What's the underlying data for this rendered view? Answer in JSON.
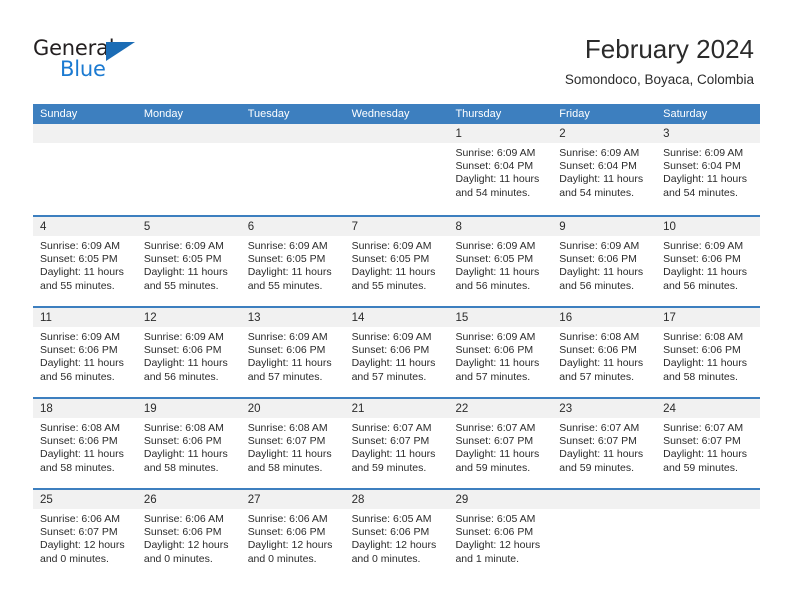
{
  "brand": {
    "name_part1": "General",
    "name_part2": "Blue",
    "triangle_color": "#1b6cb5",
    "blue_color": "#1b7ad1"
  },
  "header": {
    "title": "February 2024",
    "subtitle": "Somondoco, Boyaca, Colombia"
  },
  "theme": {
    "header_blue": "#3d7fbf",
    "day_band_gray": "#f1f1f1",
    "text_color": "#2b2b2b"
  },
  "weekdays": [
    "Sunday",
    "Monday",
    "Tuesday",
    "Wednesday",
    "Thursday",
    "Friday",
    "Saturday"
  ],
  "weeks": [
    [
      {
        "day": "",
        "sunrise": "",
        "sunset": "",
        "daylight1": "",
        "daylight2": ""
      },
      {
        "day": "",
        "sunrise": "",
        "sunset": "",
        "daylight1": "",
        "daylight2": ""
      },
      {
        "day": "",
        "sunrise": "",
        "sunset": "",
        "daylight1": "",
        "daylight2": ""
      },
      {
        "day": "",
        "sunrise": "",
        "sunset": "",
        "daylight1": "",
        "daylight2": ""
      },
      {
        "day": "1",
        "sunrise": "Sunrise: 6:09 AM",
        "sunset": "Sunset: 6:04 PM",
        "daylight1": "Daylight: 11 hours",
        "daylight2": "and 54 minutes."
      },
      {
        "day": "2",
        "sunrise": "Sunrise: 6:09 AM",
        "sunset": "Sunset: 6:04 PM",
        "daylight1": "Daylight: 11 hours",
        "daylight2": "and 54 minutes."
      },
      {
        "day": "3",
        "sunrise": "Sunrise: 6:09 AM",
        "sunset": "Sunset: 6:04 PM",
        "daylight1": "Daylight: 11 hours",
        "daylight2": "and 54 minutes."
      }
    ],
    [
      {
        "day": "4",
        "sunrise": "Sunrise: 6:09 AM",
        "sunset": "Sunset: 6:05 PM",
        "daylight1": "Daylight: 11 hours",
        "daylight2": "and 55 minutes."
      },
      {
        "day": "5",
        "sunrise": "Sunrise: 6:09 AM",
        "sunset": "Sunset: 6:05 PM",
        "daylight1": "Daylight: 11 hours",
        "daylight2": "and 55 minutes."
      },
      {
        "day": "6",
        "sunrise": "Sunrise: 6:09 AM",
        "sunset": "Sunset: 6:05 PM",
        "daylight1": "Daylight: 11 hours",
        "daylight2": "and 55 minutes."
      },
      {
        "day": "7",
        "sunrise": "Sunrise: 6:09 AM",
        "sunset": "Sunset: 6:05 PM",
        "daylight1": "Daylight: 11 hours",
        "daylight2": "and 55 minutes."
      },
      {
        "day": "8",
        "sunrise": "Sunrise: 6:09 AM",
        "sunset": "Sunset: 6:05 PM",
        "daylight1": "Daylight: 11 hours",
        "daylight2": "and 56 minutes."
      },
      {
        "day": "9",
        "sunrise": "Sunrise: 6:09 AM",
        "sunset": "Sunset: 6:06 PM",
        "daylight1": "Daylight: 11 hours",
        "daylight2": "and 56 minutes."
      },
      {
        "day": "10",
        "sunrise": "Sunrise: 6:09 AM",
        "sunset": "Sunset: 6:06 PM",
        "daylight1": "Daylight: 11 hours",
        "daylight2": "and 56 minutes."
      }
    ],
    [
      {
        "day": "11",
        "sunrise": "Sunrise: 6:09 AM",
        "sunset": "Sunset: 6:06 PM",
        "daylight1": "Daylight: 11 hours",
        "daylight2": "and 56 minutes."
      },
      {
        "day": "12",
        "sunrise": "Sunrise: 6:09 AM",
        "sunset": "Sunset: 6:06 PM",
        "daylight1": "Daylight: 11 hours",
        "daylight2": "and 56 minutes."
      },
      {
        "day": "13",
        "sunrise": "Sunrise: 6:09 AM",
        "sunset": "Sunset: 6:06 PM",
        "daylight1": "Daylight: 11 hours",
        "daylight2": "and 57 minutes."
      },
      {
        "day": "14",
        "sunrise": "Sunrise: 6:09 AM",
        "sunset": "Sunset: 6:06 PM",
        "daylight1": "Daylight: 11 hours",
        "daylight2": "and 57 minutes."
      },
      {
        "day": "15",
        "sunrise": "Sunrise: 6:09 AM",
        "sunset": "Sunset: 6:06 PM",
        "daylight1": "Daylight: 11 hours",
        "daylight2": "and 57 minutes."
      },
      {
        "day": "16",
        "sunrise": "Sunrise: 6:08 AM",
        "sunset": "Sunset: 6:06 PM",
        "daylight1": "Daylight: 11 hours",
        "daylight2": "and 57 minutes."
      },
      {
        "day": "17",
        "sunrise": "Sunrise: 6:08 AM",
        "sunset": "Sunset: 6:06 PM",
        "daylight1": "Daylight: 11 hours",
        "daylight2": "and 58 minutes."
      }
    ],
    [
      {
        "day": "18",
        "sunrise": "Sunrise: 6:08 AM",
        "sunset": "Sunset: 6:06 PM",
        "daylight1": "Daylight: 11 hours",
        "daylight2": "and 58 minutes."
      },
      {
        "day": "19",
        "sunrise": "Sunrise: 6:08 AM",
        "sunset": "Sunset: 6:06 PM",
        "daylight1": "Daylight: 11 hours",
        "daylight2": "and 58 minutes."
      },
      {
        "day": "20",
        "sunrise": "Sunrise: 6:08 AM",
        "sunset": "Sunset: 6:07 PM",
        "daylight1": "Daylight: 11 hours",
        "daylight2": "and 58 minutes."
      },
      {
        "day": "21",
        "sunrise": "Sunrise: 6:07 AM",
        "sunset": "Sunset: 6:07 PM",
        "daylight1": "Daylight: 11 hours",
        "daylight2": "and 59 minutes."
      },
      {
        "day": "22",
        "sunrise": "Sunrise: 6:07 AM",
        "sunset": "Sunset: 6:07 PM",
        "daylight1": "Daylight: 11 hours",
        "daylight2": "and 59 minutes."
      },
      {
        "day": "23",
        "sunrise": "Sunrise: 6:07 AM",
        "sunset": "Sunset: 6:07 PM",
        "daylight1": "Daylight: 11 hours",
        "daylight2": "and 59 minutes."
      },
      {
        "day": "24",
        "sunrise": "Sunrise: 6:07 AM",
        "sunset": "Sunset: 6:07 PM",
        "daylight1": "Daylight: 11 hours",
        "daylight2": "and 59 minutes."
      }
    ],
    [
      {
        "day": "25",
        "sunrise": "Sunrise: 6:06 AM",
        "sunset": "Sunset: 6:07 PM",
        "daylight1": "Daylight: 12 hours",
        "daylight2": "and 0 minutes."
      },
      {
        "day": "26",
        "sunrise": "Sunrise: 6:06 AM",
        "sunset": "Sunset: 6:06 PM",
        "daylight1": "Daylight: 12 hours",
        "daylight2": "and 0 minutes."
      },
      {
        "day": "27",
        "sunrise": "Sunrise: 6:06 AM",
        "sunset": "Sunset: 6:06 PM",
        "daylight1": "Daylight: 12 hours",
        "daylight2": "and 0 minutes."
      },
      {
        "day": "28",
        "sunrise": "Sunrise: 6:05 AM",
        "sunset": "Sunset: 6:06 PM",
        "daylight1": "Daylight: 12 hours",
        "daylight2": "and 0 minutes."
      },
      {
        "day": "29",
        "sunrise": "Sunrise: 6:05 AM",
        "sunset": "Sunset: 6:06 PM",
        "daylight1": "Daylight: 12 hours",
        "daylight2": "and 1 minute."
      },
      {
        "day": "",
        "sunrise": "",
        "sunset": "",
        "daylight1": "",
        "daylight2": ""
      },
      {
        "day": "",
        "sunrise": "",
        "sunset": "",
        "daylight1": "",
        "daylight2": ""
      }
    ]
  ]
}
